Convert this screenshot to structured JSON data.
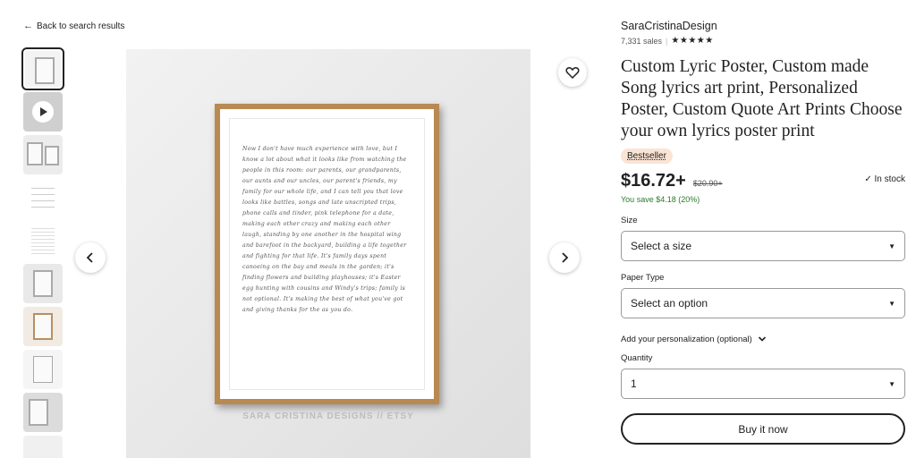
{
  "nav": {
    "back_label": "Back to search results"
  },
  "gallery": {
    "watermark": "SARA CRISTINA DESIGNS // ETSY",
    "script_text": "Now I don't have much experience with love, but I know a lot about what it looks like from watching the people in this room: our parents, our grandparents, our aunts and our uncles, our parent's friends, my family for our whole life, and I can tell you that love looks like battles, songs and late unscripted trips, phone calls and tinder, pink telephone for a date, making each other crazy and making each other laugh, standing by one another in the hospital wing and barefoot in the backyard, building a life together and fighting for that life. It's family days spent canoeing on the bay and meals in the garden; it's finding flowers and building playhouses; it's Easter egg hunting with cousins and Windy's trips; family is not optional. It's making the best of what you've got and giving thanks for the as you do."
  },
  "product": {
    "shop_name": "SaraCristinaDesign",
    "sales": "7,331 sales",
    "rating_stars": "★★★★★",
    "title": "Custom Lyric Poster, Custom made Song lyrics art print, Personalized Poster, Custom Quote Art Prints Choose your own lyrics poster print",
    "badge": "Bestseller",
    "price": "$16.72+",
    "original_price": "$20.90+",
    "stock": "In stock",
    "savings": "You save $4.18 (20%)"
  },
  "options": {
    "size_label": "Size",
    "size_value": "Select a size",
    "paper_label": "Paper Type",
    "paper_value": "Select an option",
    "personalization_label": "Add your personalization (optional)",
    "quantity_label": "Quantity",
    "quantity_value": "1"
  },
  "actions": {
    "buy_label": "Buy it now"
  }
}
